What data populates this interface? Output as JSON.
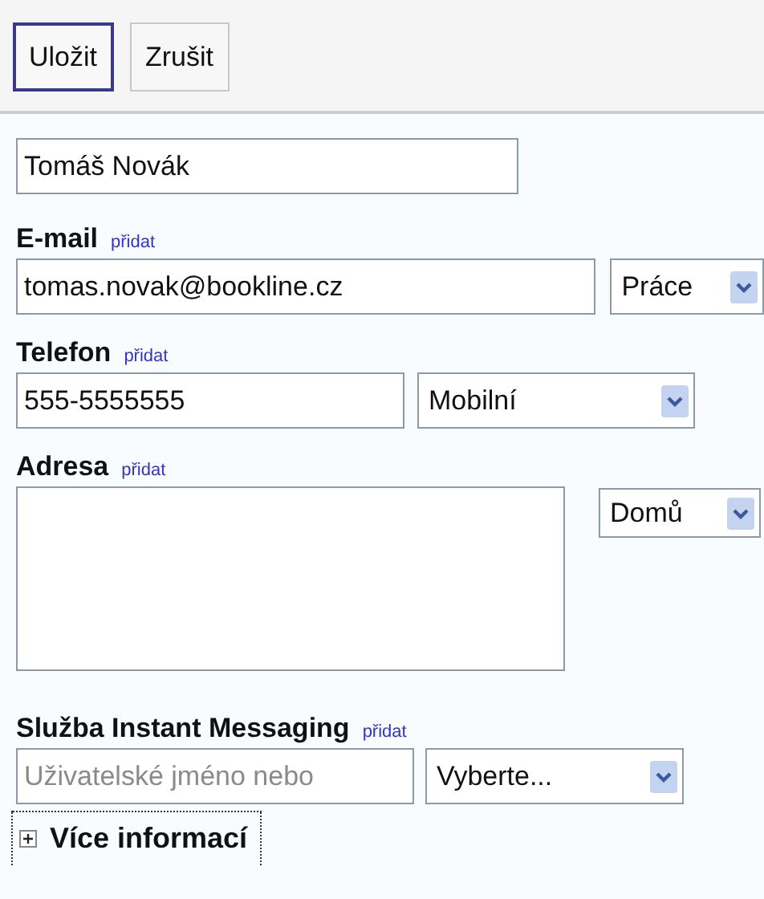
{
  "toolbar": {
    "buttons": [
      {
        "label": "Uložit",
        "selected": true
      },
      {
        "label": "Zrušit",
        "selected": false
      }
    ]
  },
  "name": {
    "value": "Tomáš Novák"
  },
  "fields": [
    {
      "kind": "email",
      "label": "E-mail",
      "link": "přidat",
      "value": "tomas.novak@bookline.cz",
      "select": "Práce"
    },
    {
      "kind": "phone",
      "label": "Telefon",
      "link": "přidat",
      "value": "555-5555555",
      "select": "Mobilní"
    },
    {
      "kind": "textarea",
      "label": "Adresa",
      "link": "přidat",
      "select": "Domů"
    },
    {
      "kind": "placeholder",
      "label": "Služba Instant Messaging",
      "link": "přidat",
      "placeholder": "Uživatelské jméno nebo",
      "select": "Vyberte..."
    }
  ],
  "more": {
    "label": "Více informací",
    "expanded": false
  }
}
